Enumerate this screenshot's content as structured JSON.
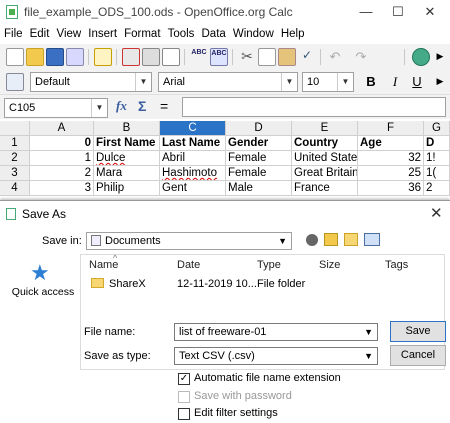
{
  "window": {
    "title": "file_example_ODS_100.ods - OpenOffice.org Calc"
  },
  "menu": [
    "File",
    "Edit",
    "View",
    "Insert",
    "Format",
    "Tools",
    "Data",
    "Window",
    "Help"
  ],
  "format_bar": {
    "style": "Default",
    "font": "Arial",
    "size": "10"
  },
  "formula_bar": {
    "cell_ref": "C105",
    "fx": "fx",
    "sum": "Σ",
    "equals": "=",
    "content": ""
  },
  "sheet": {
    "columns": [
      "A",
      "B",
      "C",
      "D",
      "E",
      "F",
      "G"
    ],
    "column_tail": "D",
    "rows": [
      {
        "num": "1",
        "a": "0",
        "b": "First Name",
        "c": "Last Name",
        "d": "Gender",
        "e": "Country",
        "f": "Age",
        "g": "D"
      },
      {
        "num": "2",
        "a": "1",
        "b": "Dulce",
        "c": "Abril",
        "d": "Female",
        "e": "United State",
        "f": "32",
        "g": "1!"
      },
      {
        "num": "3",
        "a": "2",
        "b": "Mara",
        "c": "Hashimoto",
        "d": "Female",
        "e": "Great Britain",
        "f": "25",
        "g": "1("
      },
      {
        "num": "4",
        "a": "3",
        "b": "Philip",
        "c": "Gent",
        "d": "Male",
        "e": "France",
        "f": "36",
        "g": "2"
      }
    ]
  },
  "dialog": {
    "title": "Save As",
    "save_in_label": "Save in:",
    "save_in_value": "Documents",
    "quick_access": "Quick access",
    "columns": {
      "name": "Name",
      "date": "Date",
      "type": "Type",
      "size": "Size",
      "tags": "Tags"
    },
    "files": [
      {
        "name": "ShareX",
        "date": "12-11-2019 10...",
        "type": "File folder"
      }
    ],
    "file_name_label": "File name:",
    "file_name_value": "list of freeware-01",
    "save_type_label": "Save as type:",
    "save_type_value": "Text CSV (.csv)",
    "save_button": "Save",
    "cancel_button": "Cancel",
    "auto_ext_label": "Automatic file name extension",
    "password_label": "Save with password",
    "filter_label": "Edit filter settings"
  }
}
